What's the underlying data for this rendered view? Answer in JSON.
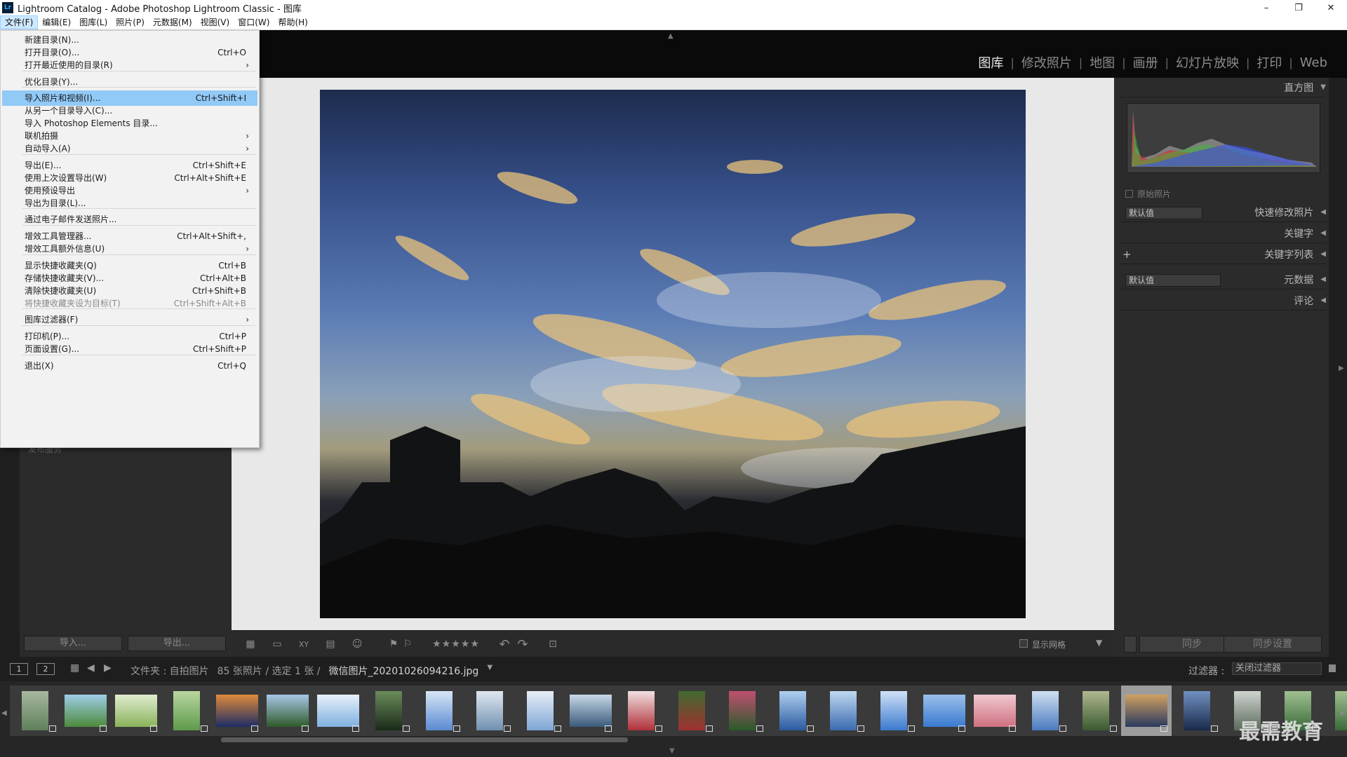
{
  "window": {
    "title": "Lightroom Catalog - Adobe Photoshop Lightroom Classic - 图库",
    "app_icon": "Lr",
    "controls": {
      "minimize": "–",
      "restore": "❐",
      "close": "✕"
    }
  },
  "menubar": [
    "文件(F)",
    "编辑(E)",
    "图库(L)",
    "照片(P)",
    "元数据(M)",
    "视图(V)",
    "窗口(W)",
    "帮助(H)"
  ],
  "modules": [
    "图库",
    "修改照片",
    "地图",
    "画册",
    "幻灯片放映",
    "打印",
    "Web"
  ],
  "file_menu": [
    {
      "label": "新建目录(N)...",
      "shortcut": "",
      "submenu": false
    },
    {
      "label": "打开目录(O)...",
      "shortcut": "Ctrl+O",
      "submenu": false
    },
    {
      "label": "打开最近使用的目录(R)",
      "shortcut": "",
      "submenu": true
    },
    {
      "label": "优化目录(Y)...",
      "shortcut": "",
      "submenu": false
    },
    {
      "label": "导入照片和视频(I)...",
      "shortcut": "Ctrl+Shift+I",
      "submenu": false
    },
    {
      "label": "从另一个目录导入(C)...",
      "shortcut": "",
      "submenu": false
    },
    {
      "label": "导入 Photoshop Elements 目录...",
      "shortcut": "",
      "submenu": false
    },
    {
      "label": "联机拍摄",
      "shortcut": "",
      "submenu": true
    },
    {
      "label": "自动导入(A)",
      "shortcut": "",
      "submenu": true
    },
    {
      "label": "导出(E)...",
      "shortcut": "Ctrl+Shift+E",
      "submenu": false
    },
    {
      "label": "使用上次设置导出(W)",
      "shortcut": "Ctrl+Alt+Shift+E",
      "submenu": false
    },
    {
      "label": "使用预设导出",
      "shortcut": "",
      "submenu": true
    },
    {
      "label": "导出为目录(L)...",
      "shortcut": "",
      "submenu": false
    },
    {
      "label": "通过电子邮件发送照片...",
      "shortcut": "",
      "submenu": false
    },
    {
      "label": "增效工具管理器...",
      "shortcut": "Ctrl+Alt+Shift+,",
      "submenu": false
    },
    {
      "label": "增效工具额外信息(U)",
      "shortcut": "",
      "submenu": true
    },
    {
      "label": "显示快捷收藏夹(Q)",
      "shortcut": "Ctrl+B",
      "submenu": false
    },
    {
      "label": "存储快捷收藏夹(V)...",
      "shortcut": "Ctrl+Alt+B",
      "submenu": false
    },
    {
      "label": "清除快捷收藏夹(U)",
      "shortcut": "Ctrl+Shift+B",
      "submenu": false
    },
    {
      "label": "将快捷收藏夹设为目标(T)",
      "shortcut": "Ctrl+Shift+Alt+B",
      "submenu": false
    },
    {
      "label": "图库过滤器(F)",
      "shortcut": "",
      "submenu": true
    },
    {
      "label": "打印机(P)...",
      "shortcut": "Ctrl+P",
      "submenu": false
    },
    {
      "label": "页面设置(G)...",
      "shortcut": "Ctrl+Shift+P",
      "submenu": false
    },
    {
      "label": "退出(X)",
      "shortcut": "Ctrl+Q",
      "submenu": false
    }
  ],
  "left_panel": {
    "hidden_section_label": "发布服务",
    "import_button": "导入...",
    "export_button": "导出..."
  },
  "toolbar": {
    "show_grid_label": "显示网格",
    "rating_stars": "★★★★★"
  },
  "right_panel": {
    "histogram_title": "直方图",
    "original_photo_label": "原始照片",
    "quick_develop_preset": "默认值",
    "quick_develop_title": "快速修改照片",
    "keywording_title": "关键字",
    "keyword_list_title": "关键字列表",
    "metadata_preset": "默认值",
    "metadata_title": "元数据",
    "comments_title": "评论",
    "sync_button": "同步",
    "sync_settings_button": "同步设置"
  },
  "filmstrip_bar": {
    "page1": "1",
    "page2": "2",
    "folder": "文件夹 : 自拍图片",
    "count": "85 张照片 / 选定 1 张 /",
    "filename": "微信图片_20201026094216.jpg",
    "filter_label": "过滤器 :",
    "filter_value": "关闭过滤器"
  },
  "filmstrip": [
    {
      "colors": [
        "#5f7f5a",
        "#a8b8a0"
      ],
      "portrait": true
    },
    {
      "colors": [
        "#4d8a3c",
        "#9fcde8"
      ],
      "portrait": false
    },
    {
      "colors": [
        "#8ab35a",
        "#e0ecd0"
      ],
      "portrait": false
    },
    {
      "colors": [
        "#5e9a4a",
        "#b9d6a0"
      ],
      "portrait": true
    },
    {
      "colors": [
        "#1d2c66",
        "#e08a3a"
      ],
      "portrait": false
    },
    {
      "colors": [
        "#2f5a2a",
        "#a8c6e8"
      ],
      "portrait": false
    },
    {
      "colors": [
        "#7fb0e0",
        "#e8f0fa"
      ],
      "portrait": false
    },
    {
      "colors": [
        "#1a2a1a",
        "#6a8c5a"
      ],
      "portrait": true
    },
    {
      "colors": [
        "#5a8ad0",
        "#d8e6f6"
      ],
      "portrait": true
    },
    {
      "colors": [
        "#7090b0",
        "#e0e8f0"
      ],
      "portrait": true
    },
    {
      "colors": [
        "#7fa6d6",
        "#e8eef6"
      ],
      "portrait": true
    },
    {
      "colors": [
        "#3a5a7a",
        "#c8d8e8"
      ],
      "portrait": false
    },
    {
      "colors": [
        "#b0303a",
        "#f0e0e0"
      ],
      "portrait": true
    },
    {
      "colors": [
        "#a03030",
        "#406a30"
      ],
      "portrait": true
    },
    {
      "colors": [
        "#2a5a2a",
        "#c05070"
      ],
      "portrait": true
    },
    {
      "colors": [
        "#2a5aa0",
        "#b0d0f0"
      ],
      "portrait": true
    },
    {
      "colors": [
        "#3a6ab0",
        "#c0d8f0"
      ],
      "portrait": true
    },
    {
      "colors": [
        "#3a7ad0",
        "#d0e0f6"
      ],
      "portrait": true
    },
    {
      "colors": [
        "#3a7ad0",
        "#9ac0ea"
      ],
      "portrait": false
    },
    {
      "colors": [
        "#d07080",
        "#f0c8d0"
      ],
      "portrait": false
    },
    {
      "colors": [
        "#4a7ac0",
        "#d0e0f0"
      ],
      "portrait": true
    },
    {
      "colors": [
        "#3a5a30",
        "#b0b890"
      ],
      "portrait": true
    },
    {
      "colors": [
        "#2a3a60",
        "#d0a060"
      ],
      "portrait": false,
      "selected": true
    },
    {
      "colors": [
        "#1a2a4a",
        "#7090c0"
      ],
      "portrait": true
    },
    {
      "colors": [
        "#5a6a5a",
        "#d0d4d0"
      ],
      "portrait": true
    },
    {
      "colors": [
        "#3a6a3a",
        "#a0c090"
      ],
      "portrait": true
    },
    {
      "colors": [
        "#3a6a3a",
        "#a0c090"
      ],
      "portrait": true
    }
  ],
  "watermark": "最需教育",
  "colors": {
    "menu_highlight": "#91c9f7",
    "panel_bg": "#2b2b2b",
    "center_bg": "#e8e8e8"
  }
}
